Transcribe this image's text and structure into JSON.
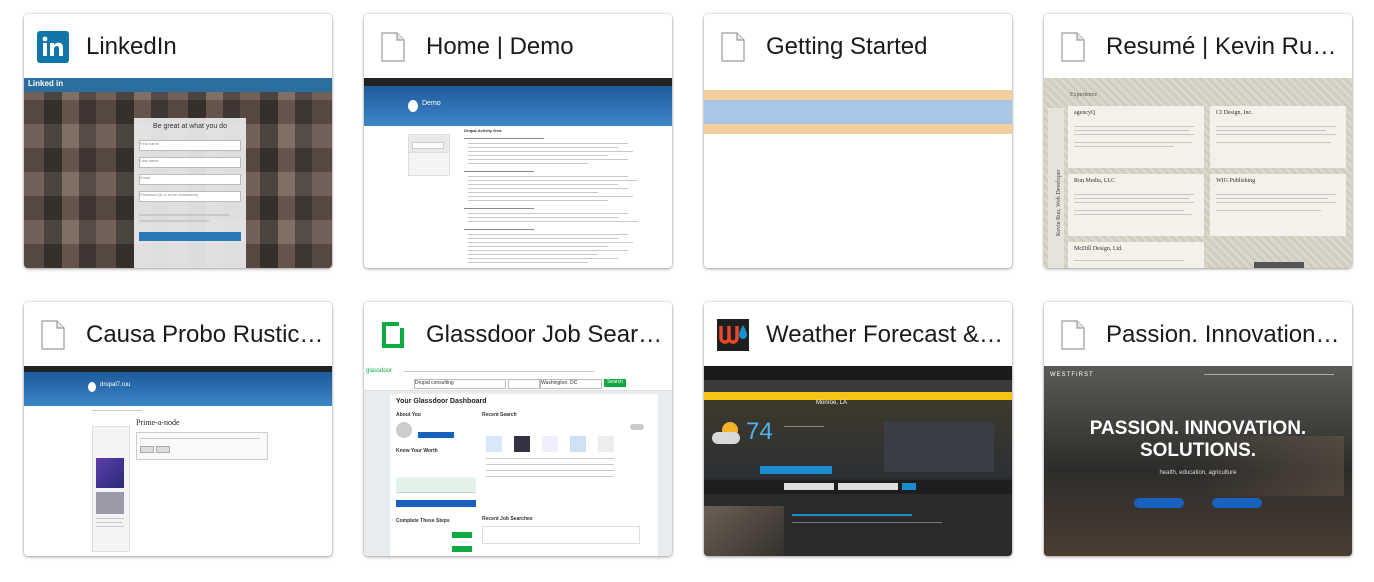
{
  "tiles": [
    {
      "title": "LinkedIn",
      "icon": "linkedin-icon"
    },
    {
      "title": "Home | Demo",
      "icon": "generic-page-icon"
    },
    {
      "title": "Getting Started",
      "icon": "generic-page-icon"
    },
    {
      "title": "Resumé | Kevin Ru…",
      "icon": "generic-page-icon"
    },
    {
      "title": "Causa Probo Rustic…",
      "icon": "generic-page-icon"
    },
    {
      "title": "Glassdoor Job Sear…",
      "icon": "glassdoor-icon"
    },
    {
      "title": "Weather Forecast &…",
      "icon": "wunderground-icon"
    },
    {
      "title": "Passion. Innovation…",
      "icon": "generic-page-icon"
    }
  ],
  "thumbs": {
    "linkedin": {
      "heading": "Be great at what you do",
      "logo": "Linked in",
      "fields": [
        "First name",
        "Last name",
        "Email",
        "Password (6 or more characters)"
      ]
    },
    "demo": {
      "site": "Demo",
      "heading": "Drupal Activity feed"
    },
    "resume": {
      "section": "Experience",
      "sidebar": "Kevin Ruu, Web Developer",
      "jobs": [
        "agencyQ",
        "CI Design, Inc.",
        "Ron Media, LLC",
        "WIG Publishing",
        "McDill Design, Ltd."
      ]
    },
    "causa": {
      "site": "drupal7.ruu",
      "heading": "Prime-a-node"
    },
    "glassdoor": {
      "logo": "glassdoor",
      "search_value": "Drupal consulting",
      "location": "Washington, DC",
      "button": "Search",
      "dashboard": "Your Glassdoor Dashboard",
      "about": "About You",
      "worth": "Know Your Worth",
      "recent": "Recent Search",
      "steps": "Complete These Steps",
      "recent_jobs": "Recent Job Searches"
    },
    "weather": {
      "temp": "74",
      "city": "Monroe, LA"
    },
    "passion": {
      "logo": "WESTFIRST",
      "headline1": "PASSION. INNOVATION.",
      "headline2": "SOLUTIONS.",
      "tagline": "health, education, agriculture"
    }
  },
  "colors": {
    "linkedin": "#0e76a8",
    "glassdoor": "#0caa41",
    "wu_red": "#e8472b",
    "wu_blue": "#1a8dcf"
  }
}
